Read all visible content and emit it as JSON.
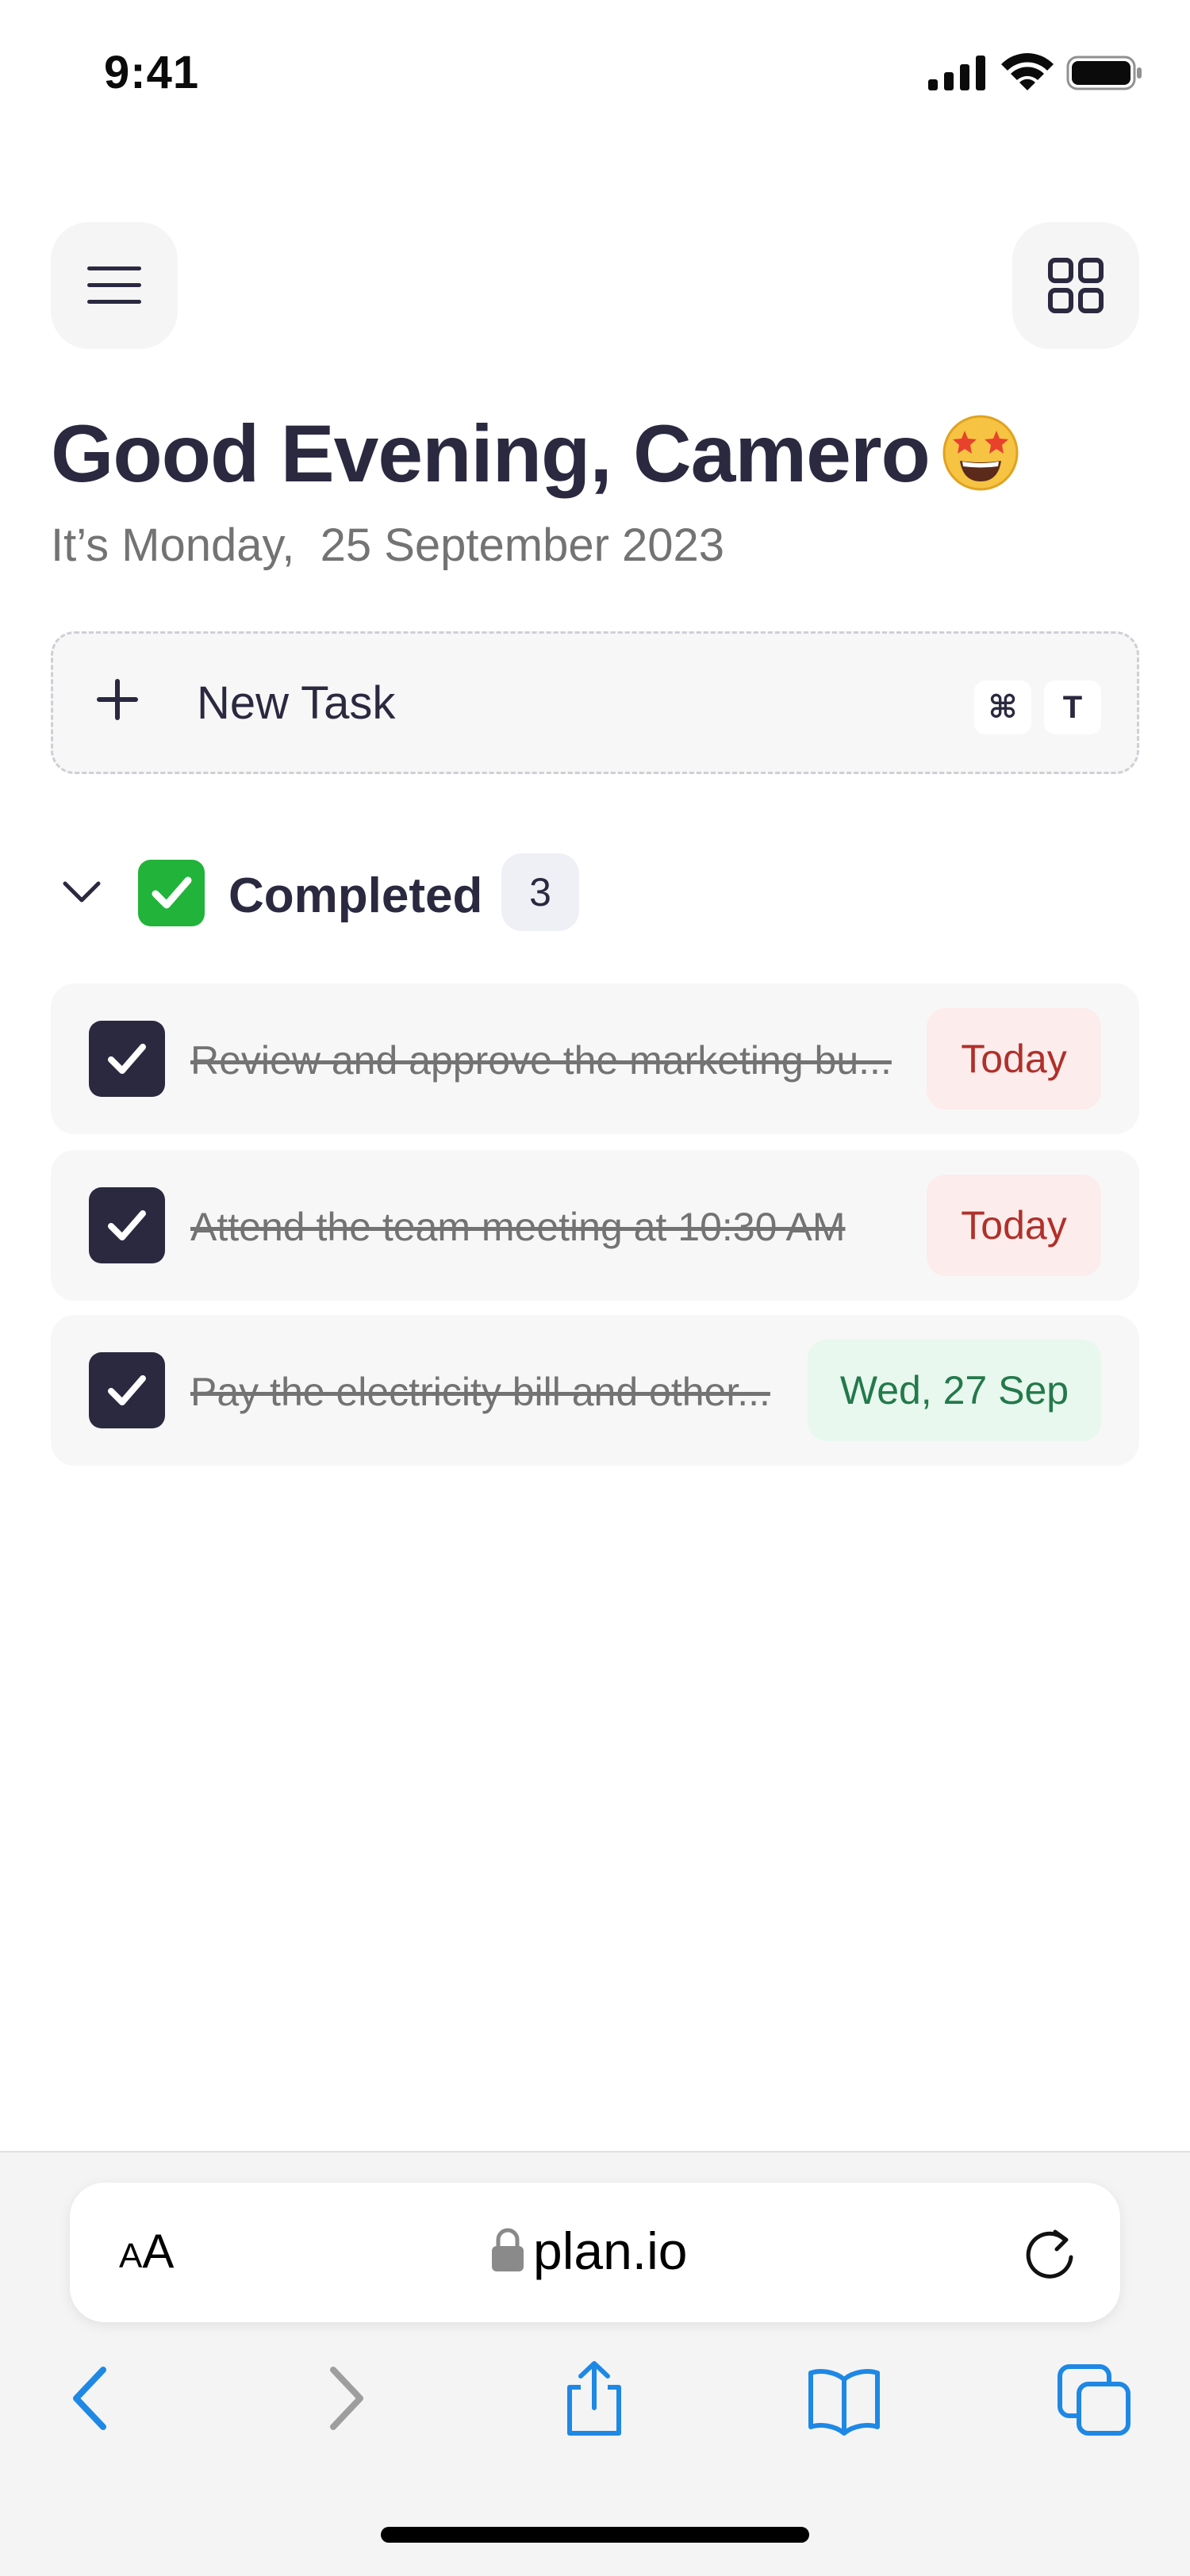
{
  "status_bar": {
    "time": "9:41"
  },
  "header": {
    "greeting": "Good Evening, Camero",
    "date_prefix": "It’s Monday,",
    "date_value": "25 September 2023"
  },
  "new_task": {
    "label": "New Task",
    "shortcut_key_1": "⌘",
    "shortcut_key_2": "T"
  },
  "completed_section": {
    "title": "Completed",
    "count": "3"
  },
  "tasks": [
    {
      "text": "Review and approve the marketing bu...",
      "due": "Today",
      "due_status": "red"
    },
    {
      "text": "Attend the team meeting at 10:30 AM",
      "due": "Today",
      "due_status": "red"
    },
    {
      "text": "Pay the electricity bill and other...",
      "due": "Wed, 27 Sep",
      "due_status": "green"
    }
  ],
  "browser": {
    "text_size_label_small": "A",
    "text_size_label_large": "A",
    "url": "plan.io"
  },
  "colors": {
    "accent_dark": "#2b2940",
    "due_today": "#b0302a",
    "due_future": "#23794a",
    "ios_blue": "#1e88e5"
  }
}
